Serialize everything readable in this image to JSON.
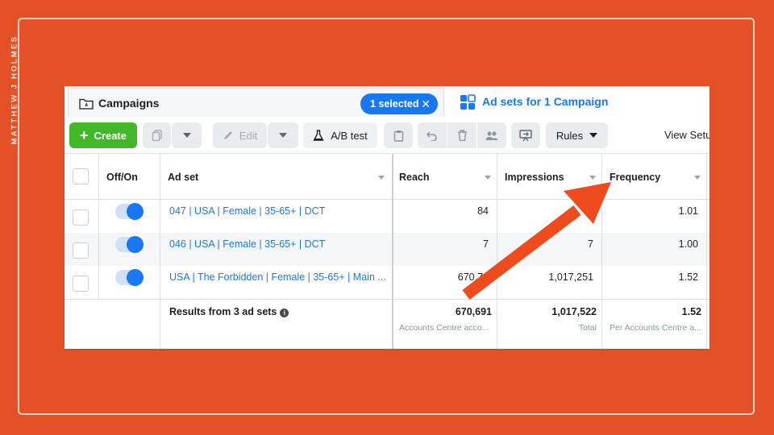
{
  "overlay": {
    "vertical_text": "MATTHEW J HOLMES"
  },
  "tabs": {
    "campaigns_label": "Campaigns",
    "selected_badge": "1 selected",
    "adsets_label": "Ad sets for 1 Campaign"
  },
  "toolbar": {
    "create_label": "Create",
    "edit_label": "Edit",
    "abtest_label": "A/B test",
    "rules_label": "Rules",
    "view_setup_label": "View Setu"
  },
  "table": {
    "headers": {
      "offon": "Off/On",
      "adset": "Ad set",
      "reach": "Reach",
      "impressions": "Impressions",
      "frequency": "Frequency"
    },
    "rows": [
      {
        "name": "047 | USA | Female | 35-65+ | DCT",
        "reach": "84",
        "impressions": "",
        "frequency": "1.01",
        "on": true
      },
      {
        "name": "046 | USA | Female | 35-65+ | DCT",
        "reach": "7",
        "impressions": "7",
        "frequency": "1.00",
        "on": true
      },
      {
        "name": "USA | The Forbidden | Female | 35-65+ | Main ...",
        "reach": "670,71",
        "impressions": "1,017,251",
        "frequency": "1.52",
        "on": true
      }
    ],
    "totals": {
      "label": "Results from 3 ad sets",
      "reach": "670,691",
      "reach_sub": "Accounts Centre acco...",
      "impressions": "1,017,522",
      "impressions_sub": "Total",
      "frequency": "1.52",
      "frequency_sub": "Per Accounts Centre a..."
    }
  },
  "colors": {
    "background": "#e55126",
    "accent": "#1877f2",
    "create": "#42b72a",
    "arrow": "#ee4b1f"
  }
}
